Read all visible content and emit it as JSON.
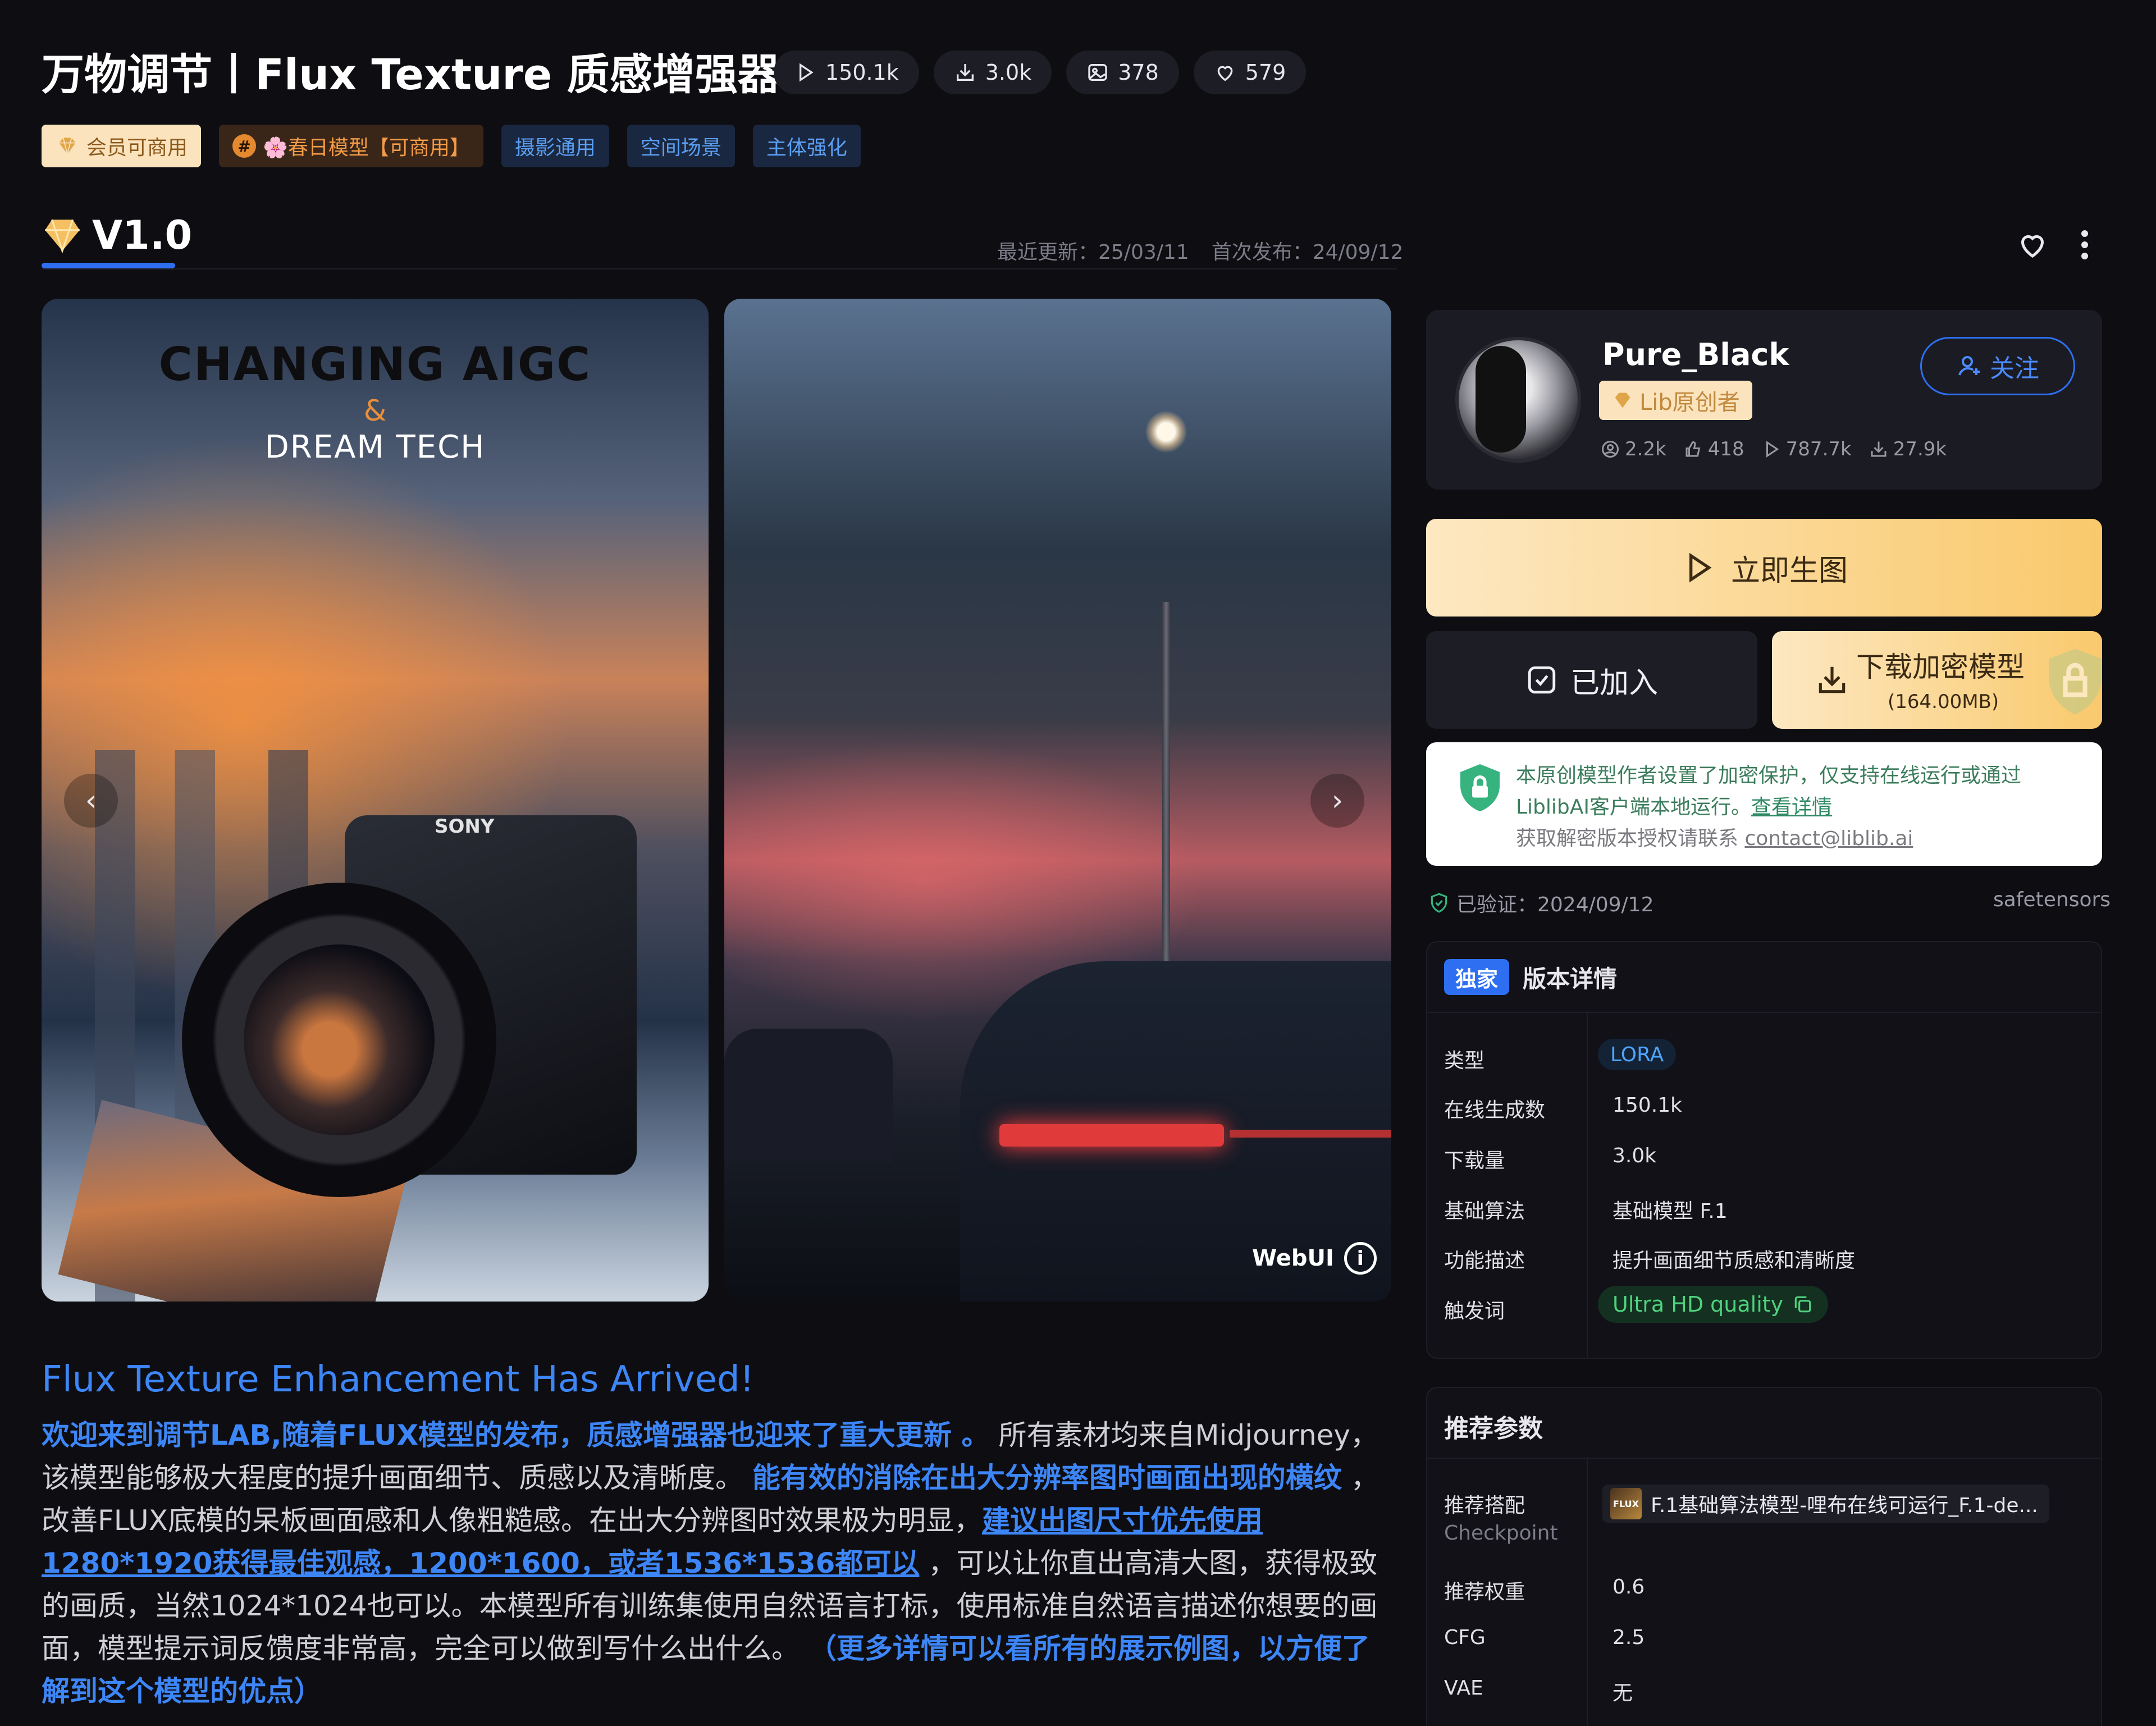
{
  "header": {
    "title": "万物调节丨Flux Texture 质感增强器",
    "stats": [
      {
        "icon": "play-icon",
        "value": "150.1k"
      },
      {
        "icon": "download-icon",
        "value": "3.0k"
      },
      {
        "icon": "image-icon",
        "value": "378"
      },
      {
        "icon": "heart-icon",
        "value": "579"
      }
    ],
    "tags": {
      "vip": "会员可商用",
      "event": "🌸春日模型【可商用】",
      "t1": "摄影通用",
      "t2": "空间场景",
      "t3": "主体强化"
    }
  },
  "version": {
    "label": "V1.0",
    "updated": "最近更新：25/03/11",
    "published": "首次发布：24/09/12"
  },
  "gallery": {
    "image1": {
      "line1": "CHANGING AIGC",
      "line2": "&",
      "line3": "DREAM TECH",
      "brand": "SONY"
    },
    "image2": {
      "watermark": "WebUI"
    },
    "prev_label": "‹",
    "next_label": "›"
  },
  "description": {
    "title": "Flux Texture Enhancement Has Arrived!",
    "p_hl1": "欢迎来到调节LAB,随着FLUX模型的发布，质感增强器也迎来了重大更新 。",
    "p_t1": " 所有素材均来自Midjourney，该模型能够极大程度的提升画面细节、质感以及清晰度。 ",
    "p_hl2": "能有效的消除在出大分辨率图时画面出现的横纹",
    "p_t2": " ，改善FLUX底模的呆板画面感和人像粗糙感。在出大分辨图时效果极为明显，",
    "p_link": "建议出图尺寸优先使用1280*1920获得最佳观感，1200*1600，或者1536*1536都可以",
    "p_t3": " ，可以让你直出高清大图，获得极致的画质，当然1024*1024也可以。本模型所有训练集使用自然语言打标，使用标准自然语言描述你想要的画面，模型提示词反馈度非常高，完全可以做到写什么出什么。 ",
    "p_hl3": "（更多详情可以看所有的展示例图，以方便了解到这个模型的优点）"
  },
  "author": {
    "name": "Pure_Black",
    "badge": "Lib原创者",
    "follow_label": "关注",
    "stats": [
      "2.2k",
      "418",
      "787.7k",
      "27.9k"
    ]
  },
  "actions": {
    "generate_label": "立即生图",
    "added_label": "已加入",
    "download_label": "下载加密模型",
    "download_size": "(164.00MB)"
  },
  "encryption": {
    "line1": "本原创模型作者设置了加密保护，仅支持在线运行或通过",
    "line2_text": "LiblibAI客户端本地运行。",
    "line2_link": "查看详情",
    "line3_text": "获取解密版本授权请联系 ",
    "line3_mail": "contact@liblib.ai"
  },
  "verification": {
    "text": "已验证：2024/09/12",
    "format": "safetensors"
  },
  "details": {
    "exclusive": "独家",
    "title": "版本详情",
    "rows": [
      {
        "label": "类型",
        "value": "LORA"
      },
      {
        "label": "在线生成数",
        "value": "150.1k"
      },
      {
        "label": "下载量",
        "value": "3.0k"
      },
      {
        "label": "基础算法",
        "value": "基础模型 F.1"
      },
      {
        "label": "功能描述",
        "value": "提升画面细节质感和清晰度"
      },
      {
        "label": "触发词",
        "value": "Ultra HD quality"
      }
    ]
  },
  "params": {
    "title": "推荐参数",
    "checkpoint_label": "推荐搭配",
    "checkpoint_sub": "Checkpoint",
    "checkpoint_value": "F.1基础算法模型-哩布在线可运行_F.1-de...",
    "checkpoint_thumb": "FLUX",
    "rows": [
      {
        "label": "推荐权重",
        "value": "0.6"
      },
      {
        "label": "CFG",
        "value": "2.5"
      },
      {
        "label": "VAE",
        "value": "无"
      }
    ]
  },
  "colors": {
    "background": "#0d0d12",
    "accent_blue": "#2e6ff2",
    "gold": "#f9c96c",
    "trigger_green": "#4fd37e"
  }
}
